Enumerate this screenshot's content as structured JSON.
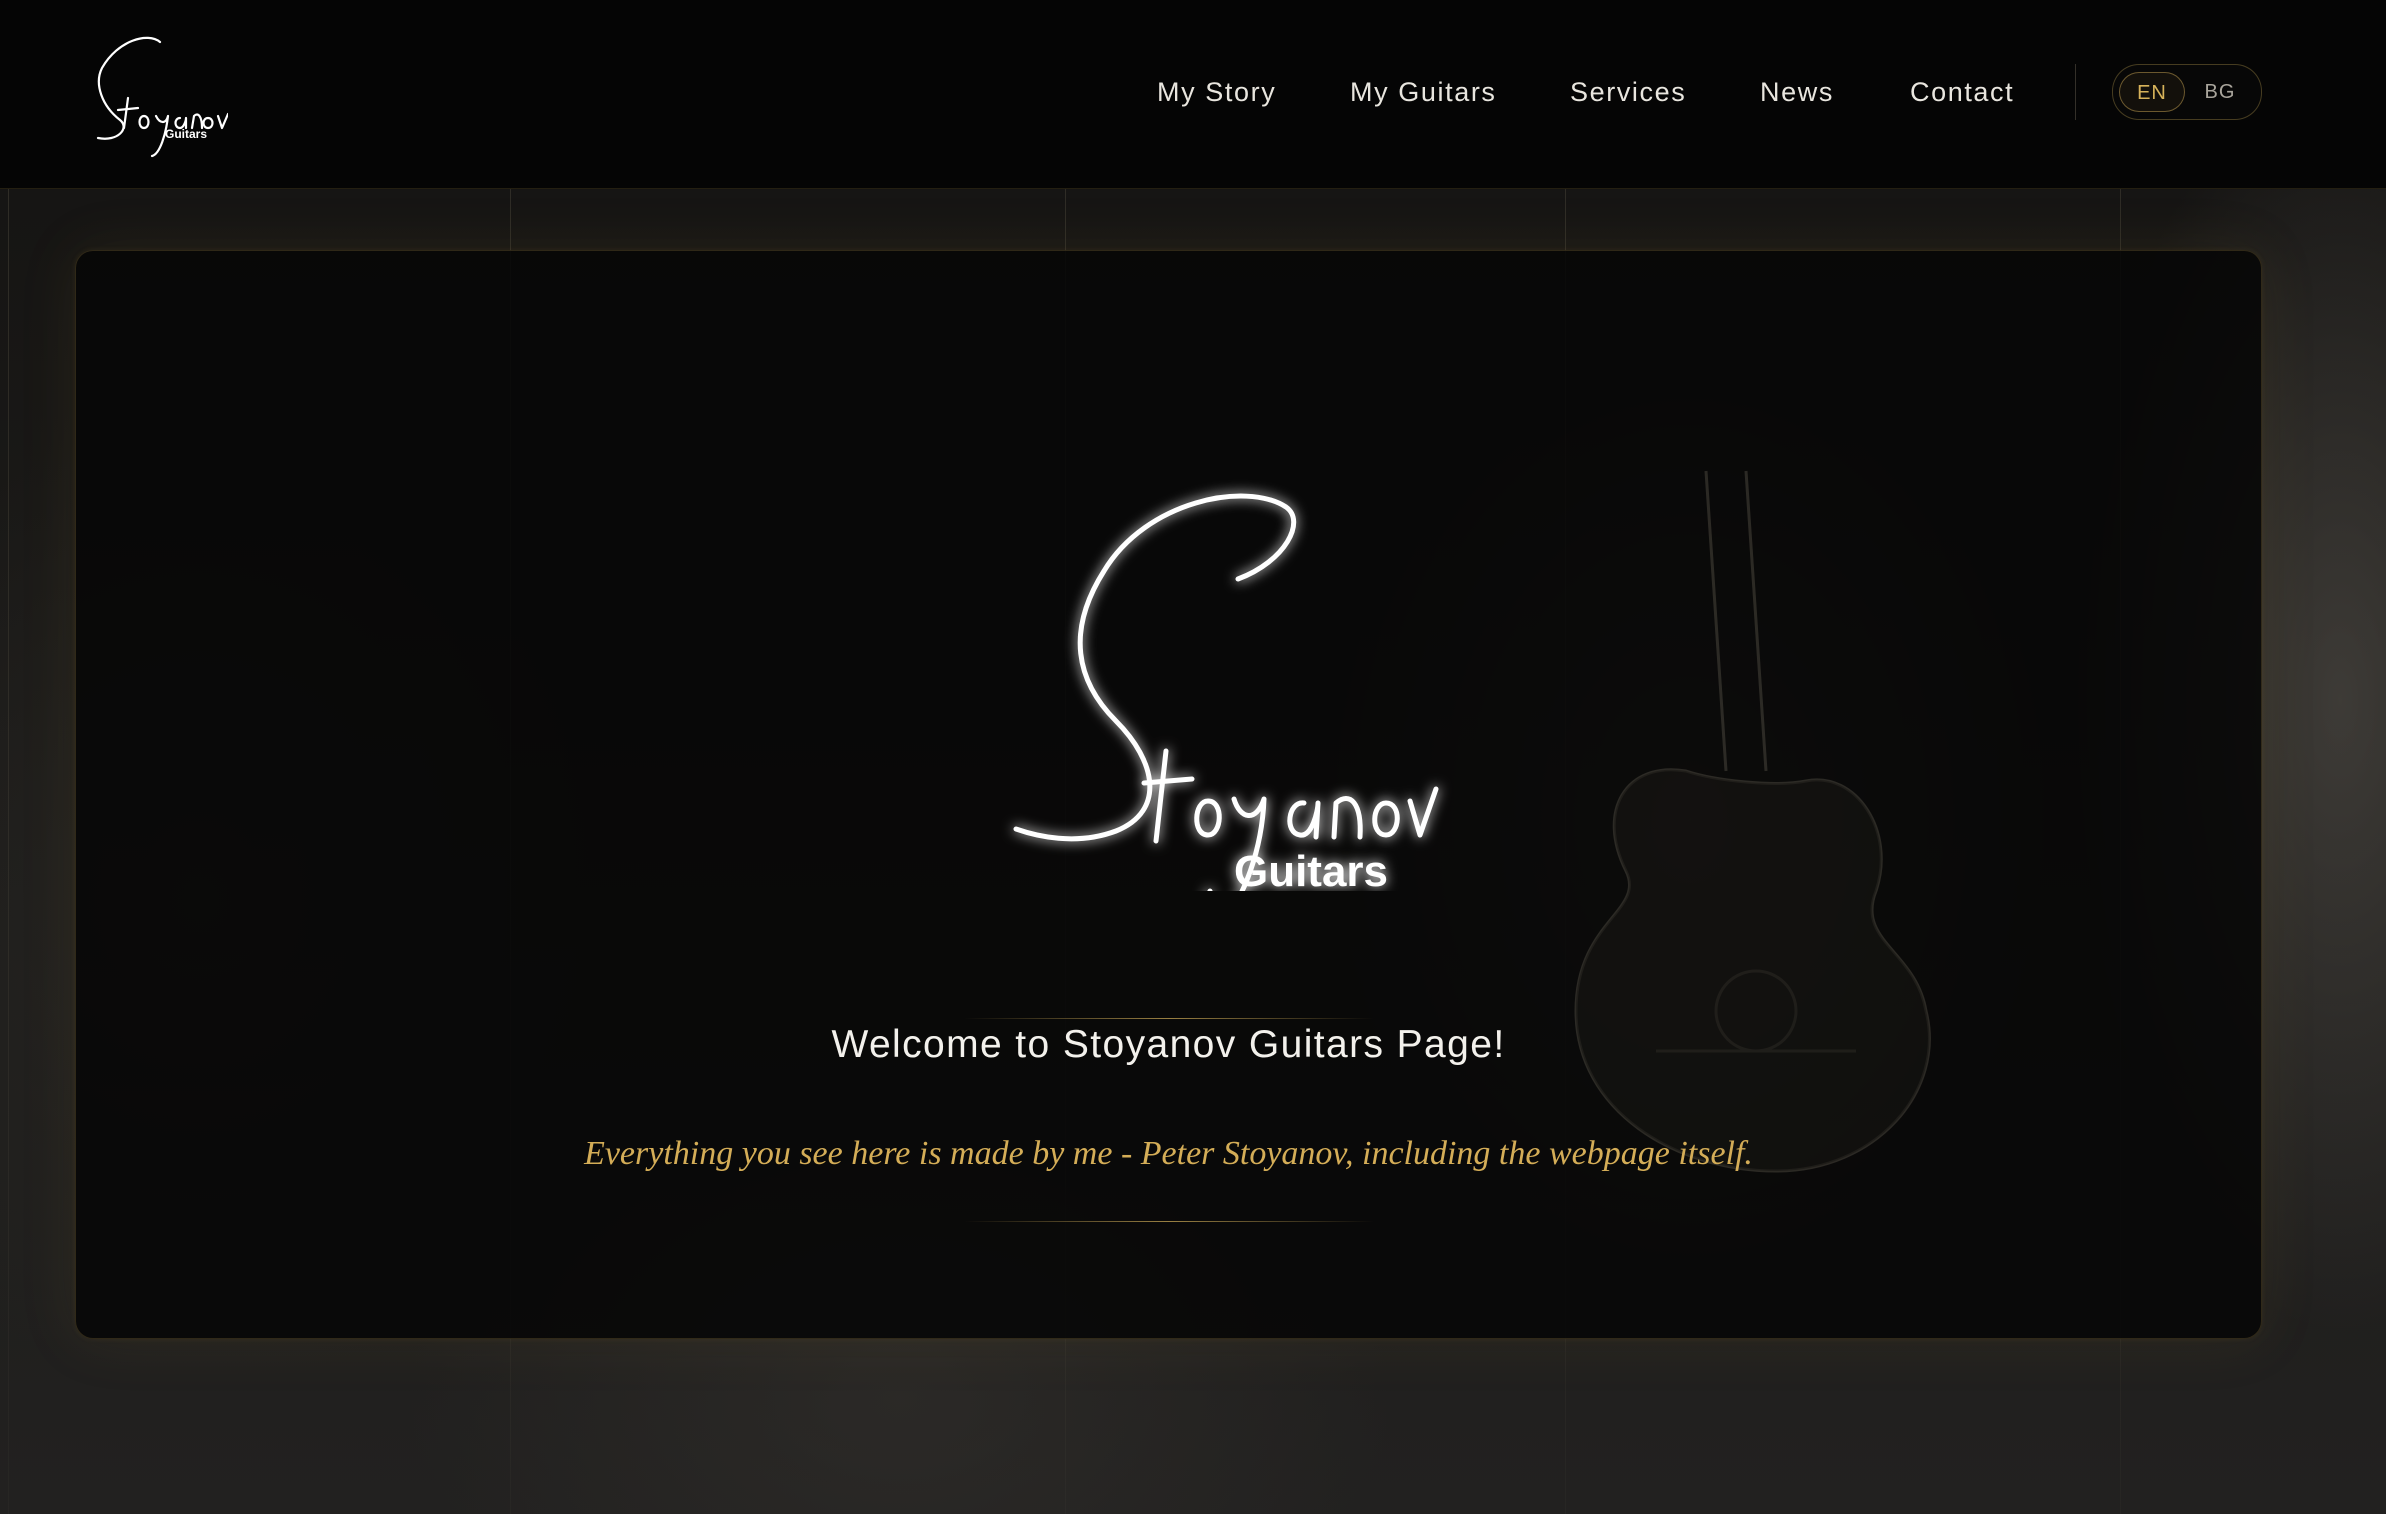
{
  "header": {
    "nav": [
      {
        "label": "My Story"
      },
      {
        "label": "My Guitars"
      },
      {
        "label": "Services"
      },
      {
        "label": "News"
      },
      {
        "label": "Contact"
      }
    ],
    "languages": [
      {
        "code": "EN",
        "active": true
      },
      {
        "code": "BG",
        "active": false
      }
    ]
  },
  "brand": {
    "script_name": "Stoyanov",
    "wordmark": "Guitars"
  },
  "hero": {
    "title": "Welcome to Stoyanov Guitars Page!",
    "subtitle": "Everything you see here is made by me - Peter Stoyanov, including the webpage itself."
  },
  "colors": {
    "accent_gold": "#d4ad57",
    "text_light": "#f3f1ec",
    "background": "#050505"
  }
}
